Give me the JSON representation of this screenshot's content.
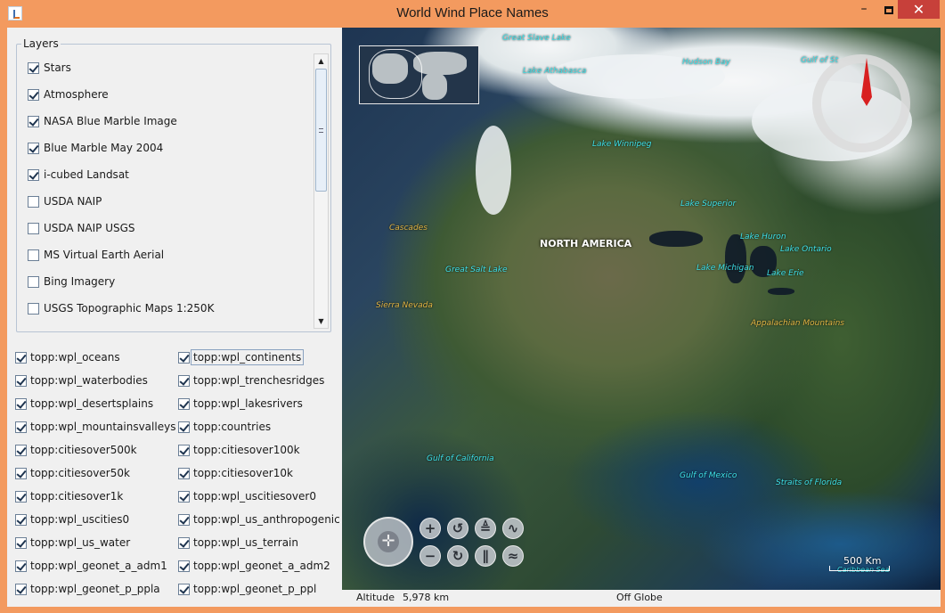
{
  "window": {
    "title": "World Wind Place Names",
    "controls": {
      "minimize": "–",
      "maximize": "□",
      "close": "✕"
    }
  },
  "layers_panel": {
    "legend": "Layers",
    "items": [
      {
        "label": "Stars",
        "checked": true
      },
      {
        "label": "Atmosphere",
        "checked": true
      },
      {
        "label": "NASA Blue Marble Image",
        "checked": true
      },
      {
        "label": "Blue Marble May 2004",
        "checked": true
      },
      {
        "label": "i-cubed Landsat",
        "checked": true
      },
      {
        "label": "USDA NAIP",
        "checked": false
      },
      {
        "label": "USDA NAIP USGS",
        "checked": false
      },
      {
        "label": "MS Virtual Earth Aerial",
        "checked": false
      },
      {
        "label": "Bing Imagery",
        "checked": false
      },
      {
        "label": "USGS Topographic Maps 1:250K",
        "checked": false
      }
    ]
  },
  "place_name_layers": {
    "left": [
      {
        "label": "topp:wpl_oceans",
        "checked": true
      },
      {
        "label": "topp:wpl_waterbodies",
        "checked": true
      },
      {
        "label": "topp:wpl_desertsplains",
        "checked": true
      },
      {
        "label": "topp:wpl_mountainsvalleys",
        "checked": true
      },
      {
        "label": "topp:citiesover500k",
        "checked": true
      },
      {
        "label": "topp:citiesover50k",
        "checked": true
      },
      {
        "label": "topp:citiesover1k",
        "checked": true
      },
      {
        "label": "topp:wpl_uscities0",
        "checked": true
      },
      {
        "label": "topp:wpl_us_water",
        "checked": true
      },
      {
        "label": "topp:wpl_geonet_a_adm1",
        "checked": true
      },
      {
        "label": "topp:wpl_geonet_p_ppla",
        "checked": true
      }
    ],
    "right": [
      {
        "label": "topp:wpl_continents",
        "checked": true
      },
      {
        "label": "topp:wpl_trenchesridges",
        "checked": true
      },
      {
        "label": "topp:wpl_lakesrivers",
        "checked": true
      },
      {
        "label": "topp:countries",
        "checked": true
      },
      {
        "label": "topp:citiesover100k",
        "checked": true
      },
      {
        "label": "topp:citiesover10k",
        "checked": true
      },
      {
        "label": "topp:wpl_uscitiesover0",
        "checked": true
      },
      {
        "label": "topp:wpl_us_anthropogenic",
        "checked": true
      },
      {
        "label": "topp:wpl_us_terrain",
        "checked": true
      },
      {
        "label": "topp:wpl_geonet_a_adm2",
        "checked": true
      },
      {
        "label": "topp:wpl_geonet_p_ppl",
        "checked": true
      }
    ]
  },
  "map": {
    "place_names": {
      "great_slave_lake": "Great Slave Lake",
      "lake_athabasca": "Lake Athabasca",
      "hudson_bay": "Hudson Bay",
      "gulf_of_st": "Gulf of St",
      "lake_winnipeg": "Lake Winnipeg",
      "lake_superior": "Lake Superior",
      "cascades": "Cascades",
      "north_america": "NORTH AMERICA",
      "lake_huron": "Lake Huron",
      "lake_ontario": "Lake Ontario",
      "great_salt_lake": "Great Salt Lake",
      "lake_michigan": "Lake Michigan",
      "lake_erie": "Lake Erie",
      "sierra_nevada": "Sierra Nevada",
      "appalachian_mountains": "Appalachian Mountains",
      "gulf_of_california": "Gulf of California",
      "gulf_of_mexico": "Gulf of Mexico",
      "straits_of_florida": "Straits of Florida",
      "caribbean_sea": "Caribbean Sea"
    },
    "scale_label": "500 Km",
    "colors": {
      "water_label": "#3ee0e8",
      "mountain_label": "#e2b544",
      "compass_needle": "#d82020"
    }
  },
  "nav_controls": {
    "pan": "✛",
    "zoom_in": "+",
    "zoom_out": "−",
    "heading_left": "↺",
    "heading_right": "↻",
    "pitch_up": "≜",
    "pitch_down": "∥",
    "exaggeration_up": "∿",
    "exaggeration_down": "≈"
  },
  "status": {
    "altitude_label": "Altitude",
    "altitude_value": "5,978 km",
    "position": "Off Globe"
  }
}
